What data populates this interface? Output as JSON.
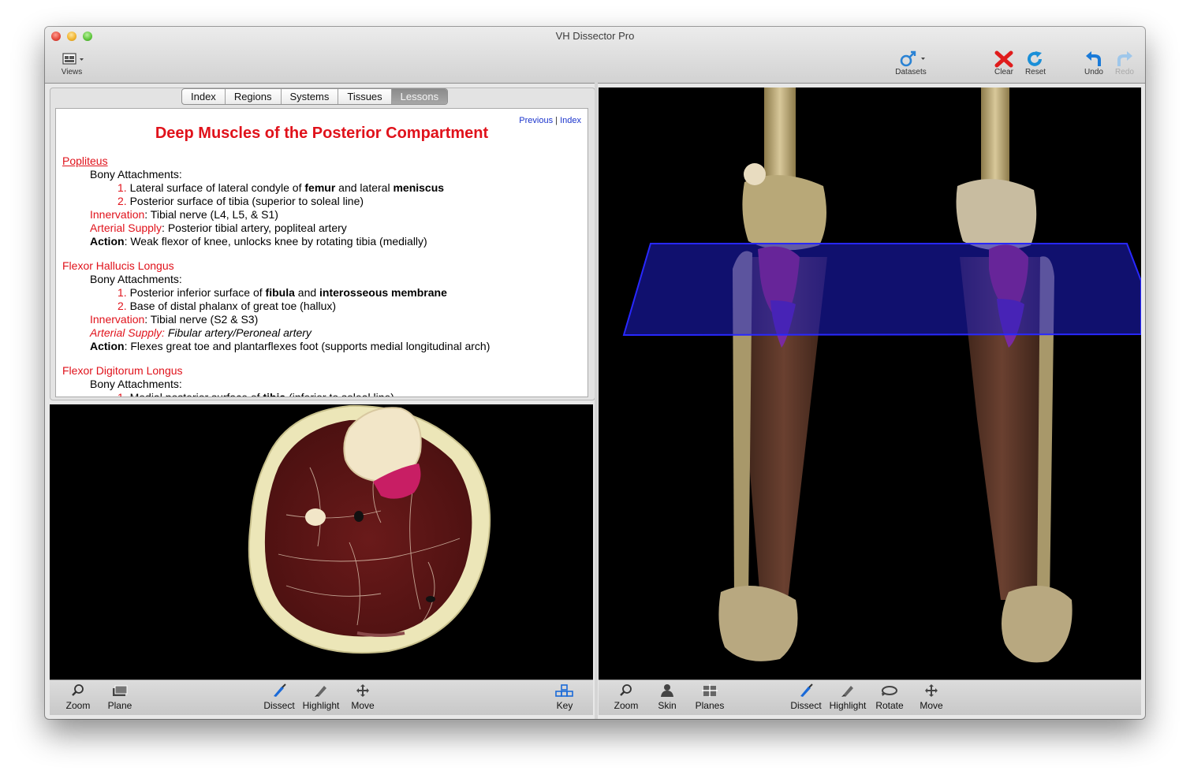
{
  "window": {
    "title": "VH Dissector Pro"
  },
  "toolbar": {
    "views_label": "Views",
    "datasets_label": "Datasets",
    "clear_label": "Clear",
    "reset_label": "Reset",
    "undo_label": "Undo",
    "redo_label": "Redo"
  },
  "tabs": [
    "Index",
    "Regions",
    "Systems",
    "Tissues",
    "Lessons"
  ],
  "lesson": {
    "nav_previous": "Previous",
    "nav_sep": "|",
    "nav_index": "Index",
    "title": "Deep Muscles of the Posterior Compartment",
    "popliteus": {
      "name": "Popliteus",
      "bony_label": "Bony Attachments:",
      "attach1_num": "1.",
      "attach1_a": "Lateral surface of lateral condyle of ",
      "attach1_b": "femur",
      "attach1_c": " and lateral ",
      "attach1_d": "meniscus",
      "attach2_num": "2.",
      "attach2": "Posterior surface of tibia (superior to soleal line)",
      "innervation_label": "Innervation",
      "innervation": ": Tibial nerve (L4, L5, & S1)",
      "arterial_label": "Arterial Supply",
      "arterial": ": Posterior tibial artery, popliteal artery",
      "action_label": "Action",
      "action": ": Weak flexor of knee, unlocks knee by rotating tibia (medially)"
    },
    "fhl": {
      "name": "Flexor Hallucis Longus",
      "bony_label": "Bony Attachments:",
      "attach1_num": "1.",
      "attach1_a": "Posterior inferior surface of ",
      "attach1_b": "fibula",
      "attach1_c": " and ",
      "attach1_d": "interosseous membrane",
      "attach2_num": "2.",
      "attach2": "Base of distal phalanx of great toe (hallux)",
      "innervation_label": "Innervation",
      "innervation": ": Tibial nerve (S2 & S3)",
      "arterial_label": "Arterial Supply:",
      "arterial": " Fibular artery/Peroneal artery",
      "action_label": "Action",
      "action": ": Flexes great toe and plantarflexes foot (supports medial longitudinal arch)"
    },
    "fdl": {
      "name": "Flexor Digitorum Longus",
      "bony_label": "Bony Attachments:",
      "attach1_num": "1.",
      "attach1_a": "Medial posterior surface of ",
      "attach1_b": "tibia",
      "attach1_c": " (inferior to soleal line)"
    }
  },
  "left_bottom_bar": {
    "zoom": "Zoom",
    "plane": "Plane",
    "dissect": "Dissect",
    "highlight": "Highlight",
    "move": "Move",
    "key": "Key"
  },
  "right_bottom_bar": {
    "zoom": "Zoom",
    "skin": "Skin",
    "planes": "Planes",
    "dissect": "Dissect",
    "highlight": "Highlight",
    "rotate": "Rotate",
    "move": "Move"
  },
  "colors": {
    "accent_red": "#e0121b",
    "link_blue": "#1a33cc",
    "highlight_magenta": "#c81e64",
    "plane_blue": "#1e1ec8"
  },
  "icons": {
    "views": "views-icon",
    "datasets": "datasets-icon",
    "clear": "clear-x-icon",
    "reset": "reset-icon",
    "undo": "undo-icon",
    "redo": "redo-icon",
    "zoom": "magnifier-icon",
    "plane": "plane-icon",
    "dissect": "scalpel-icon",
    "highlight": "marker-icon",
    "move": "move-arrows-icon",
    "key": "key-icon",
    "skin": "person-icon",
    "planes": "planes-icon",
    "rotate": "rotate-icon"
  }
}
